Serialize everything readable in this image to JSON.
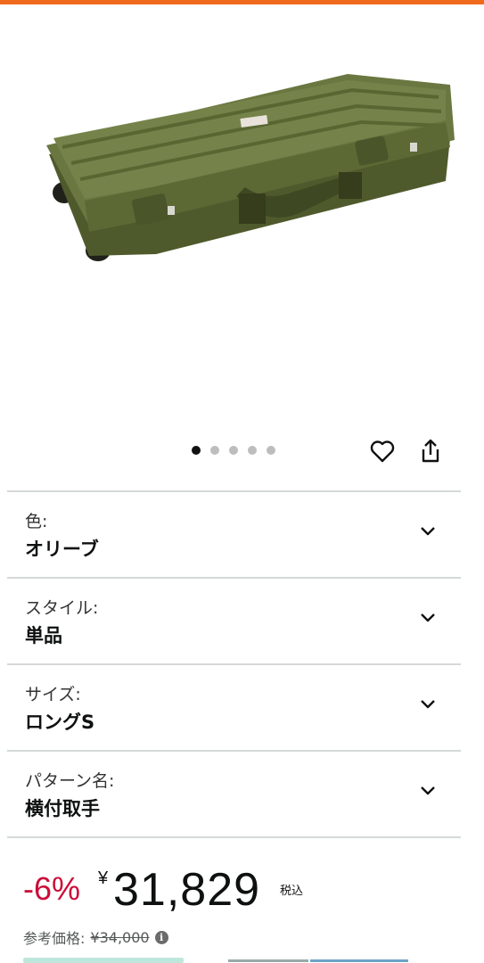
{
  "gallery": {
    "dot_count": 5,
    "active_index": 0,
    "image_icon": "olive-hard-case-product-photo"
  },
  "actions": {
    "heart_icon": "heart-outline-icon",
    "share_icon": "share-upload-icon"
  },
  "options": [
    {
      "label": "色:",
      "value": "オリーブ"
    },
    {
      "label": "スタイル:",
      "value": "単品"
    },
    {
      "label": "サイズ:",
      "value": "ロングS"
    },
    {
      "label": "パターン名:",
      "value": "横付取手"
    }
  ],
  "pricing": {
    "discount": "-6%",
    "currency_symbol": "¥",
    "price": "31,829",
    "tax_label": "税込",
    "reference_label": "参考価格:",
    "reference_price": "¥34,000"
  },
  "colors": {
    "accent_top_bar": "#f06a1d",
    "discount_red": "#cc0c39",
    "case_olive": "#5d6b36"
  }
}
